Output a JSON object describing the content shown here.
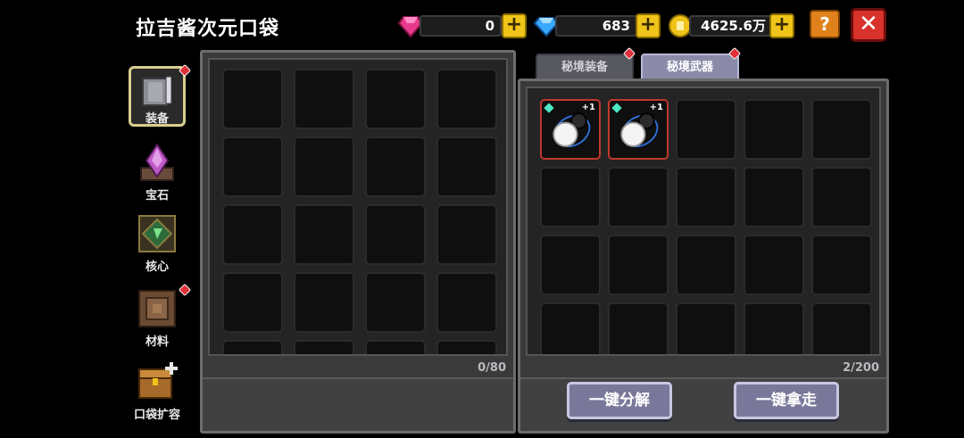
{
  "header": {
    "title": "拉吉酱次元口袋",
    "gems": {
      "value": "0",
      "icon": "pink-gem-icon",
      "color": "#e83a8c"
    },
    "diamonds": {
      "value": "683",
      "icon": "blue-diamond-icon",
      "color": "#3aa8ff"
    },
    "coins": {
      "value": "4625.6万",
      "icon": "gold-coin-icon",
      "color": "#f0c419"
    },
    "plus_label": "+",
    "help_label": "?",
    "close_label": "✕"
  },
  "sidebar": {
    "items": [
      {
        "label": "装备",
        "icon": "armor-icon",
        "active": true,
        "badge": true
      },
      {
        "label": "宝石",
        "icon": "gem-crystal-icon",
        "active": false,
        "badge": false
      },
      {
        "label": "核心",
        "icon": "core-icon",
        "active": false,
        "badge": false
      },
      {
        "label": "材料",
        "icon": "material-icon",
        "active": false,
        "badge": true
      },
      {
        "label": "口袋扩容",
        "icon": "chest-icon",
        "active": false,
        "badge": false
      }
    ]
  },
  "left_panel": {
    "count": "0/80"
  },
  "right_panel": {
    "tabs": [
      {
        "label": "秘境装备",
        "active": false
      },
      {
        "label": "秘境武器",
        "active": true
      }
    ],
    "count": "2/200",
    "items": [
      {
        "icon": "bomb-weapon-icon",
        "level": "+1"
      },
      {
        "icon": "bomb-weapon-icon",
        "level": "+1"
      }
    ],
    "buttons": {
      "decompose": "一键分解",
      "take_all": "一键拿走"
    }
  }
}
